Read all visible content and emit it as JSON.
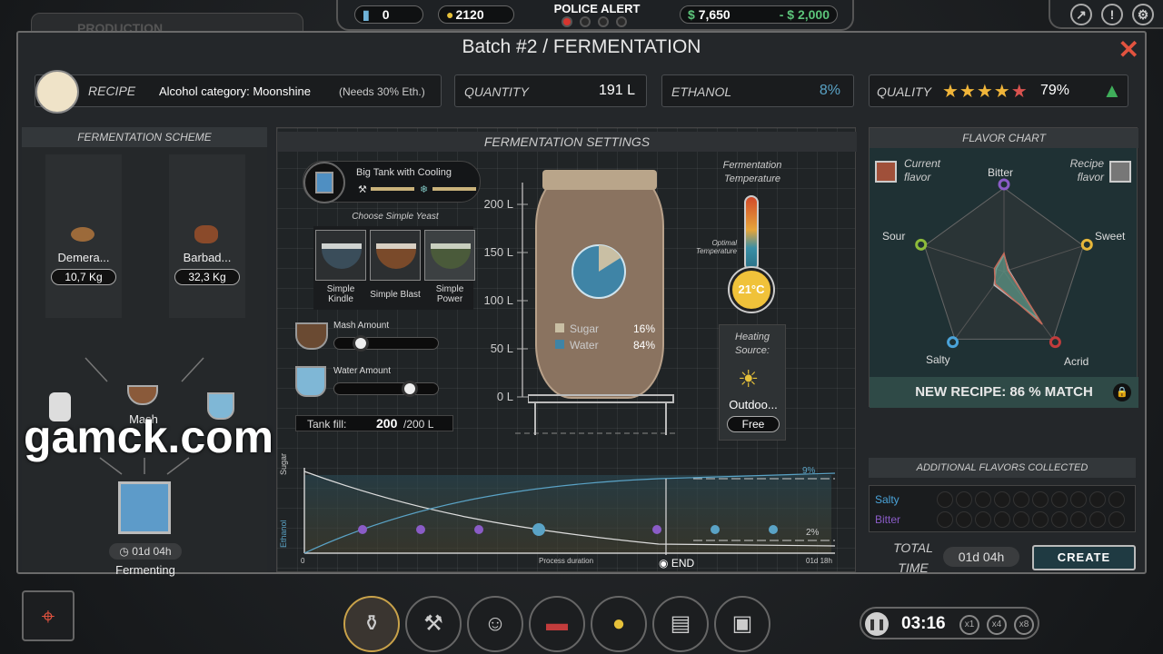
{
  "top": {
    "production_tab": "PRODUCTION",
    "battery_value": "0",
    "ideas_value": "2120",
    "police_alert": "POLICE ALERT",
    "money": "7,650",
    "money_delta": "- $ 2,000",
    "dollar_sign": "$"
  },
  "header": {
    "title": "Batch #2 / FERMENTATION",
    "recipe_label": "RECIPE",
    "recipe_value": "Alcohol category: Moonshine",
    "recipe_note": "(Needs 30% Eth.)",
    "quantity_label": "QUANTITY",
    "quantity_value": "191 L",
    "ethanol_label": "ETHANOL",
    "ethanol_value": "8%",
    "quality_label": "QUALITY",
    "quality_value": "79%",
    "quality_stars": 4.5
  },
  "scheme": {
    "title": "FERMENTATION SCHEME",
    "ing1_name": "Demera...",
    "ing1_kg": "10,7 Kg",
    "ing2_name": "Barbad...",
    "ing2_kg": "32,3 Kg",
    "mash": "Mash",
    "time": "01d 04h",
    "status": "Fermenting"
  },
  "settings": {
    "title": "FERMENTATION SETTINGS",
    "tank_name": "Big Tank with Cooling",
    "choose_yeast": "Choose Simple Yeast",
    "yeast1": "Simple Kindle",
    "yeast2": "Simple Blast",
    "yeast3": "Simple Power",
    "mash_amount": "Mash Amount",
    "mash_level": 0.2,
    "water_amount": "Water Amount",
    "water_level": 0.75,
    "tank_fill_label": "Tank fill:",
    "tank_fill_value": "200",
    "tank_fill_max": "/200 L",
    "ticks": [
      "200 L",
      "150 L",
      "100 L",
      "50 L",
      "0 L"
    ],
    "sugar_label": "Sugar",
    "sugar_pct": "16%",
    "sugar_frac": 0.16,
    "water_label": "Water",
    "water_pct": "84%",
    "temp_title": "Fermentation Temperature",
    "optimal": "Optimal Temperature",
    "temp_value": "21°C",
    "heating_title": "Heating Source:",
    "heating_value": "Outdoo...",
    "heating_cost": "Free",
    "graph_sugar": "Sugar",
    "graph_ethanol": "Ethanol",
    "graph_zero": "0",
    "graph_duration": "Process duration",
    "graph_end_time": "01d 18h",
    "graph_end": "END",
    "graph_9": "9%",
    "graph_2": "2%"
  },
  "flavor": {
    "title": "FLAVOR CHART",
    "current": "Current flavor",
    "recipe": "Recipe flavor",
    "axes": [
      "Bitter",
      "Sweet",
      "Acrid",
      "Salty",
      "Sour"
    ],
    "current_values": [
      0.22,
      0.05,
      0.78,
      0.18,
      0.12
    ],
    "recipe_values": [
      0.2,
      0.06,
      0.7,
      0.2,
      0.1
    ],
    "match": "NEW RECIPE: 86 % MATCH",
    "additional": "ADDITIONAL FLAVORS COLLECTED",
    "salty": "Salty",
    "bitter": "Bitter",
    "total_time_label": "TOTAL TIME",
    "total_time": "01d 04h",
    "create": "CREATE"
  },
  "bottom": {
    "clock": "03:16",
    "speed1": "x1",
    "speed4": "x4",
    "speed8": "x8"
  },
  "watermark": "gamck.com",
  "colors": {
    "accent": "#5aa3c6",
    "close": "#e2533f",
    "bitter": "#8a5cc7",
    "sweet": "#e6b73a",
    "acrid": "#c23c3c",
    "salty": "#4aa3d9",
    "sour": "#8dbb3a"
  }
}
